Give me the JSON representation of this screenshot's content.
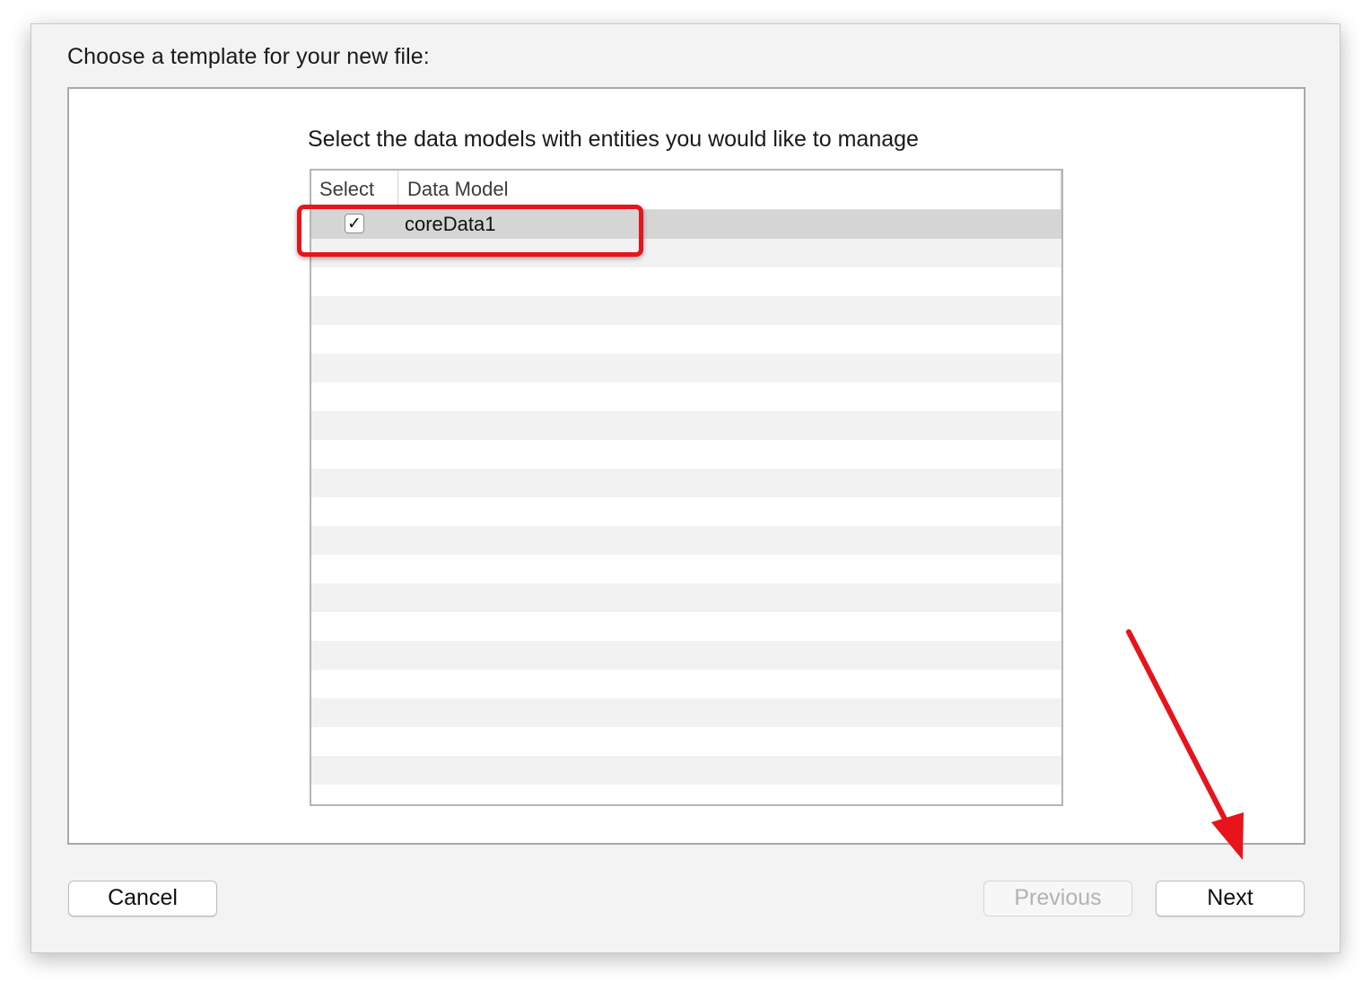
{
  "dialog": {
    "title": "Choose a template for your new file:",
    "prompt": "Select the data models with entities you would like to manage"
  },
  "table": {
    "columns": [
      {
        "label": "Select"
      },
      {
        "label": "Data Model"
      }
    ],
    "rows": [
      {
        "checked": true,
        "check_glyph": "✓",
        "model": "coreData1"
      }
    ]
  },
  "buttons": {
    "cancel": "Cancel",
    "previous": "Previous",
    "next": "Next",
    "previous_enabled": false
  },
  "annotations": {
    "highlight_color": "#e8131b",
    "arrow_color": "#e8131b"
  }
}
